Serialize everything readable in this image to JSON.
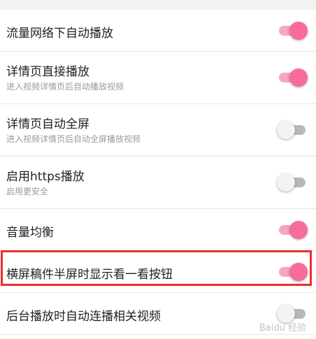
{
  "settings": [
    {
      "title": "流量网络下自动播放",
      "subtitle": "",
      "enabled": true
    },
    {
      "title": "详情页直接播放",
      "subtitle": "进入视频详情页后自动播放视频",
      "enabled": true
    },
    {
      "title": "详情页自动全屏",
      "subtitle": "进入视频详情页后自动全屏播放视频",
      "enabled": false
    },
    {
      "title": "启用https播放",
      "subtitle": "启用更安全",
      "enabled": false
    },
    {
      "title": "音量均衡",
      "subtitle": "",
      "enabled": true
    },
    {
      "title": "横屏稿件半屏时显示看一看按钮",
      "subtitle": "",
      "enabled": true
    },
    {
      "title": "后台播放时自动连播相关视频",
      "subtitle": "",
      "enabled": false
    }
  ],
  "colors": {
    "toggle_on_knob": "#f76c98",
    "toggle_on_track": "#f7a6bf",
    "toggle_off_knob": "#f3f3f3",
    "toggle_off_track": "#b8b8b8",
    "highlight_border": "#e8302d"
  },
  "watermark": "Baidu 经验"
}
